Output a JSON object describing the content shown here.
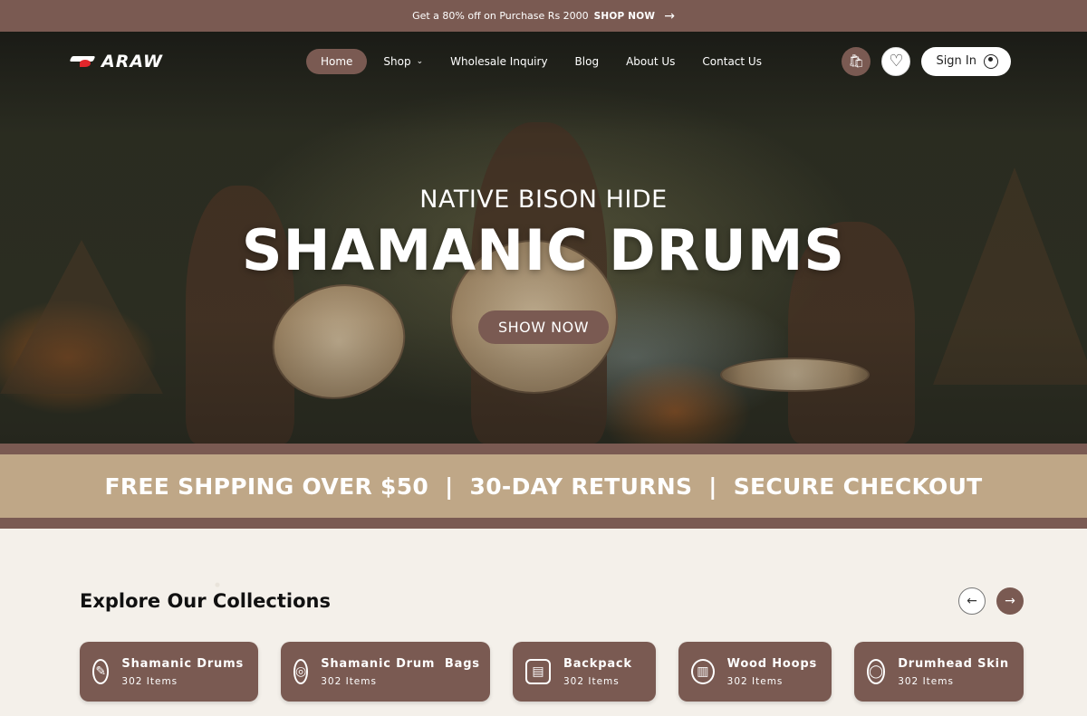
{
  "promo": {
    "text": "Get a 80% off on Purchase Rs 2000",
    "cta": "SHOP NOW",
    "arrow_icon": "arrow-right-icon"
  },
  "nav": {
    "logo_text": "ARAW",
    "items": [
      {
        "label": "Home",
        "active": true
      },
      {
        "label": "Shop",
        "has_dropdown": true
      },
      {
        "label": "Wholesale Inquiry"
      },
      {
        "label": "Blog"
      },
      {
        "label": "About Us"
      },
      {
        "label": "Contact Us"
      }
    ],
    "cart_icon": "shopping-bag-icon",
    "wishlist_icon": "heart-icon",
    "signin_label": "Sign In"
  },
  "hero": {
    "subtitle": "NATIVE BISON HIDE",
    "title": "SHAMANIC DRUMS",
    "button": "SHOW NOW"
  },
  "benefits": {
    "text": "FREE SHPPING OVER $50  |  30-DAY RETURNS  |  SECURE CHECKOUT"
  },
  "collections": {
    "title": "Explore Our Collections",
    "prev_icon": "arrow-left-icon",
    "next_icon": "arrow-right-icon",
    "items": [
      {
        "name": "Shamanic Drums",
        "count": "302 Items",
        "icon": "drum-mallet-icon"
      },
      {
        "name": "Shamanic Drum  Bags",
        "count": "302 Items",
        "icon": "drum-bag-icon"
      },
      {
        "name": "Backpack",
        "count": "302 Items",
        "icon": "backpack-icon"
      },
      {
        "name": "Wood Hoops",
        "count": "302 Items",
        "icon": "hoop-icon"
      },
      {
        "name": "Drumhead Skin",
        "count": "302 Items",
        "icon": "drumhead-icon"
      }
    ]
  },
  "colors": {
    "brand": "#7a5a52",
    "accent_beige": "#bfa787"
  }
}
